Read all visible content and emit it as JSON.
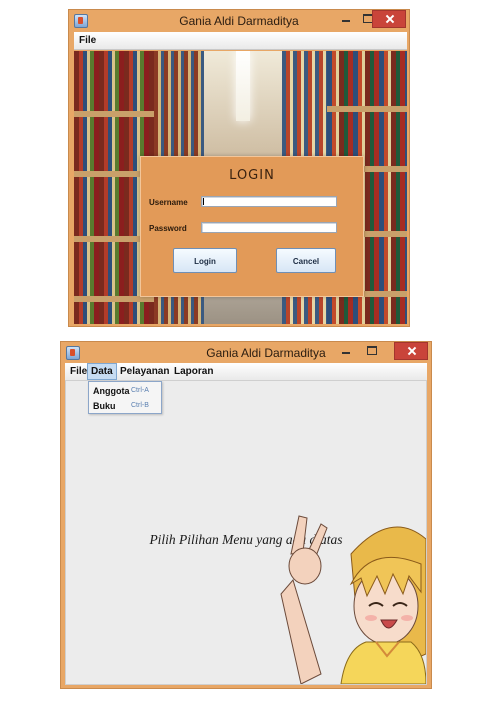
{
  "login_window": {
    "title": "Gania Aldi Darmaditya",
    "menu": [
      "File"
    ],
    "login_title": "LOGIN",
    "username_label": "Username",
    "username_value": "",
    "password_label": "Password",
    "password_value": "",
    "login_button": "Login",
    "cancel_button": "Cancel"
  },
  "main_window": {
    "title": "Gania Aldi Darmaditya",
    "menu": [
      "File",
      "Data",
      "Pelayanan",
      "Laporan"
    ],
    "active_menu": "Data",
    "data_menu_items": [
      {
        "label": "Anggota",
        "accel": "Ctrl-A"
      },
      {
        "label": "Buku",
        "accel": "Ctrl-B"
      }
    ],
    "hint_text": "Pilih Pilihan Menu yang ada diatas"
  },
  "colors": {
    "window_frame": "#e8a766",
    "login_panel": "#e29a58",
    "close_button": "#c9443a",
    "menu_highlight": "#c6dcf2"
  }
}
